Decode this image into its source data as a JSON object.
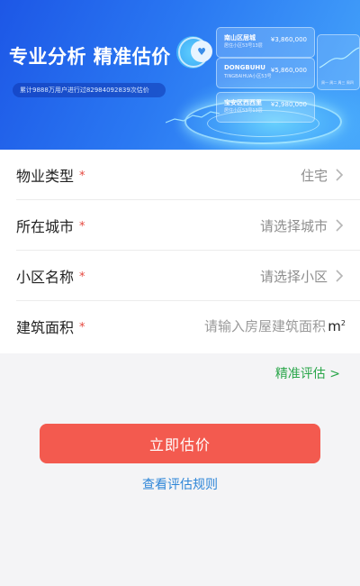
{
  "banner": {
    "headline": "专业分析 精准估价",
    "stats": "累计9888万用户进行过82984092839次估价",
    "cards": [
      {
        "name": "南山区居城",
        "sub": "居住小区53号13层",
        "price": "¥3,860,000"
      },
      {
        "name": "DONGBUHU",
        "sub": "TINGBAIHUA小区53号",
        "price": "¥5,860,000"
      },
      {
        "name": "宝安区西西里",
        "sub": "居住小区53号13层",
        "price": "¥2,980,000"
      }
    ],
    "side_axis": "周一 周二 周三 周四"
  },
  "form": {
    "property_type": {
      "label": "物业类型",
      "required": "*",
      "value": "住宅"
    },
    "city": {
      "label": "所在城市",
      "required": "*",
      "placeholder": "请选择城市"
    },
    "community": {
      "label": "小区名称",
      "required": "*",
      "placeholder": "请选择小区"
    },
    "area": {
      "label": "建筑面积",
      "required": "*",
      "placeholder": "请输入房屋建筑面积",
      "unit": "m",
      "unit_sup": "2"
    }
  },
  "precise_link": "精准评估 >",
  "submit_label": "立即估价",
  "rules_link": "查看评估规则",
  "colors": {
    "accent_red": "#f35a4f",
    "link_green": "#2aa64a",
    "link_blue": "#2e86d8",
    "required_red": "#e5483f",
    "banner_blue": "#1d57e6"
  }
}
